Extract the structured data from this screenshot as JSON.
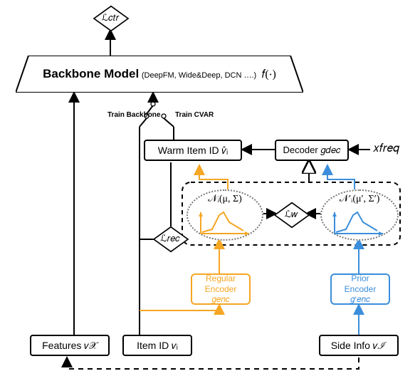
{
  "top_loss": "ℒ𝑐𝑡𝑟",
  "backbone": {
    "label_main": "Backbone Model",
    "label_sub": "(DeepFM, Wide&Deep, DCN ….)",
    "fn": "𝑓(⋅)"
  },
  "switch": {
    "left": "Train\nBackbone",
    "right": "Train\nCVAR"
  },
  "warm_box": "Warm Item ID  𝑣̂ᵢ",
  "decoder_box": "Decoder 𝑔𝑑𝑒𝑐",
  "xfreq": "𝑥𝑓𝑟𝑒𝑞",
  "dist_regular": "𝒩ᵢ(μ, Σ)",
  "dist_prior": "𝒩′ᵢ(μ′, Σ′)",
  "loss_w": "ℒ𝑤",
  "loss_rec": "ℒ𝑟𝑒𝑐",
  "reg_encoder": {
    "line1": "Regular",
    "line2": "Encoder",
    "fn": "𝑔𝑒𝑛𝑐"
  },
  "prior_encoder": {
    "line1": "Prior",
    "line2": "Encoder",
    "fn": "𝑔′𝑒𝑛𝑐"
  },
  "features_box": "Features 𝑣𝒳",
  "itemid_box": "Item ID 𝑣ᵢ",
  "sideinfo_box": "Side Info 𝑣ℐ",
  "colors": {
    "yellow": "#f5a623",
    "blue": "#3b8edb",
    "black": "#000"
  }
}
